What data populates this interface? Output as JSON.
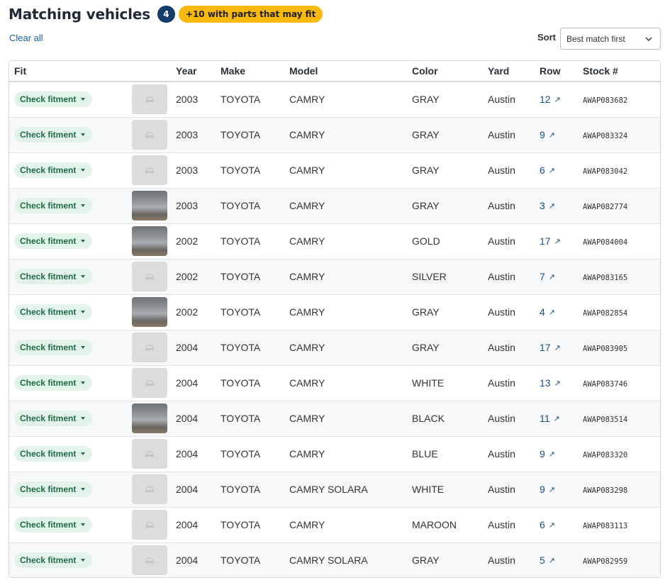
{
  "header": {
    "title": "Matching vehicles",
    "count": "4",
    "extra_badge": "+10 with parts that may fit"
  },
  "controls": {
    "clear_all": "Clear all",
    "sort_label": "Sort",
    "sort_value": "Best match first"
  },
  "table": {
    "columns": [
      "Fit",
      "",
      "Year",
      "Make",
      "Model",
      "Color",
      "Yard",
      "Row",
      "Stock #"
    ],
    "fit_label": "Check fitment",
    "rows": [
      {
        "photo": false,
        "year": "2003",
        "make": "TOYOTA",
        "model": "CAMRY",
        "color": "GRAY",
        "yard": "Austin",
        "row": "12",
        "stock": "AWAP083682"
      },
      {
        "photo": false,
        "year": "2003",
        "make": "TOYOTA",
        "model": "CAMRY",
        "color": "GRAY",
        "yard": "Austin",
        "row": "9",
        "stock": "AWAP083324"
      },
      {
        "photo": false,
        "year": "2003",
        "make": "TOYOTA",
        "model": "CAMRY",
        "color": "GRAY",
        "yard": "Austin",
        "row": "6",
        "stock": "AWAP083042"
      },
      {
        "photo": true,
        "year": "2003",
        "make": "TOYOTA",
        "model": "CAMRY",
        "color": "GRAY",
        "yard": "Austin",
        "row": "3",
        "stock": "AWAP082774"
      },
      {
        "photo": true,
        "year": "2002",
        "make": "TOYOTA",
        "model": "CAMRY",
        "color": "GOLD",
        "yard": "Austin",
        "row": "17",
        "stock": "AWAP084004"
      },
      {
        "photo": false,
        "year": "2002",
        "make": "TOYOTA",
        "model": "CAMRY",
        "color": "SILVER",
        "yard": "Austin",
        "row": "7",
        "stock": "AWAP083165"
      },
      {
        "photo": true,
        "year": "2002",
        "make": "TOYOTA",
        "model": "CAMRY",
        "color": "GRAY",
        "yard": "Austin",
        "row": "4",
        "stock": "AWAP082854"
      },
      {
        "photo": false,
        "year": "2004",
        "make": "TOYOTA",
        "model": "CAMRY",
        "color": "GRAY",
        "yard": "Austin",
        "row": "17",
        "stock": "AWAP083905"
      },
      {
        "photo": false,
        "year": "2004",
        "make": "TOYOTA",
        "model": "CAMRY",
        "color": "WHITE",
        "yard": "Austin",
        "row": "13",
        "stock": "AWAP083746"
      },
      {
        "photo": true,
        "year": "2004",
        "make": "TOYOTA",
        "model": "CAMRY",
        "color": "BLACK",
        "yard": "Austin",
        "row": "11",
        "stock": "AWAP083514"
      },
      {
        "photo": false,
        "year": "2004",
        "make": "TOYOTA",
        "model": "CAMRY",
        "color": "BLUE",
        "yard": "Austin",
        "row": "9",
        "stock": "AWAP083320"
      },
      {
        "photo": false,
        "year": "2004",
        "make": "TOYOTA",
        "model": "CAMRY SOLARA",
        "color": "WHITE",
        "yard": "Austin",
        "row": "9",
        "stock": "AWAP083298"
      },
      {
        "photo": false,
        "year": "2004",
        "make": "TOYOTA",
        "model": "CAMRY",
        "color": "MAROON",
        "yard": "Austin",
        "row": "6",
        "stock": "AWAP083113"
      },
      {
        "photo": false,
        "year": "2004",
        "make": "TOYOTA",
        "model": "CAMRY SOLARA",
        "color": "GRAY",
        "yard": "Austin",
        "row": "5",
        "stock": "AWAP082959"
      }
    ]
  },
  "icons": {
    "placeholder": "car-placeholder-icon",
    "row_link": "arrow-up-right-icon",
    "sort": "chevron-down-icon",
    "fit_caret": "caret-down-icon"
  },
  "colors": {
    "count_badge": "#143d6b",
    "extra_badge": "#f7b90f",
    "fit_button_bg": "#e2f4ea",
    "fit_button_text": "#1f6b42",
    "link": "#1a4f86"
  }
}
